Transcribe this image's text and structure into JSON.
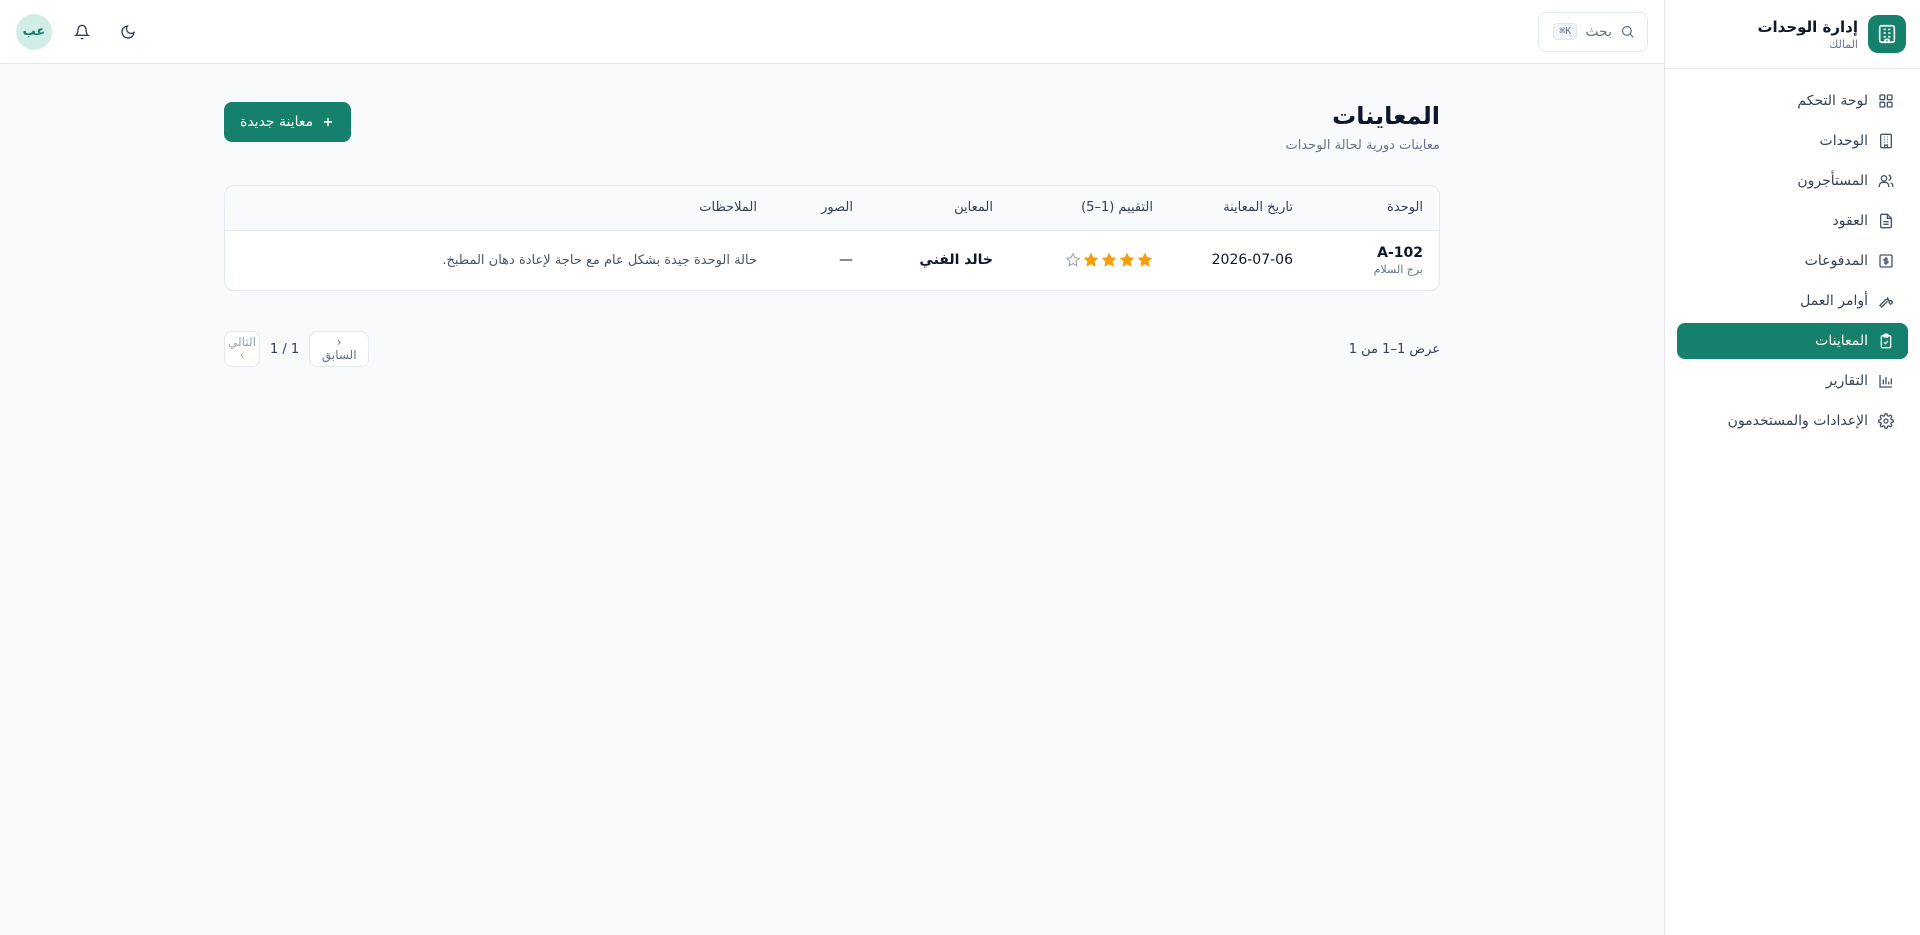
{
  "brand": {
    "title": "إدارة الوحدات",
    "subtitle": "المالك"
  },
  "sidebar": {
    "items": [
      {
        "label": "لوحة التحكم",
        "icon": "dashboard-icon"
      },
      {
        "label": "الوحدات",
        "icon": "building-icon"
      },
      {
        "label": "المستأجرون",
        "icon": "users-icon"
      },
      {
        "label": "العقود",
        "icon": "document-icon"
      },
      {
        "label": "المدفوعات",
        "icon": "dollar-icon"
      },
      {
        "label": "أوامر العمل",
        "icon": "wrench-icon"
      },
      {
        "label": "المعاينات",
        "icon": "clipboard-check-icon",
        "active": true
      },
      {
        "label": "التقارير",
        "icon": "bar-chart-icon"
      },
      {
        "label": "الإعدادات والمستخدمون",
        "icon": "gear-icon"
      }
    ]
  },
  "topbar": {
    "search_placeholder": "بحث",
    "search_shortcut": "K⌘",
    "avatar_initials": "عب"
  },
  "page": {
    "title": "المعاينات",
    "subtitle": "معاينات دورية لحالة الوحدات",
    "new_button": "معاينة جديدة"
  },
  "table": {
    "headers": [
      "الوحدة",
      "تاريخ المعاينة",
      "التقييم (1–5)",
      "المعاين",
      "الصور",
      "الملاحظات"
    ],
    "rows": [
      {
        "unit_code": "A-102",
        "building": "برج السلام",
        "date": "2026-07-06",
        "rating": 4,
        "rating_max": 5,
        "inspector": "خالد الفني",
        "photos": "—",
        "notes": "حالة الوحدة جيدة بشكل عام مع حاجة لإعادة دهان المطبخ."
      }
    ]
  },
  "pagination": {
    "summary": "عرض 1–1 من 1",
    "prev": "السابق",
    "page_info": "1 / 1",
    "next": "التالي"
  },
  "colors": {
    "accent": "#15806b",
    "star": "#f59e0b",
    "star_empty": "#94a3b8"
  }
}
